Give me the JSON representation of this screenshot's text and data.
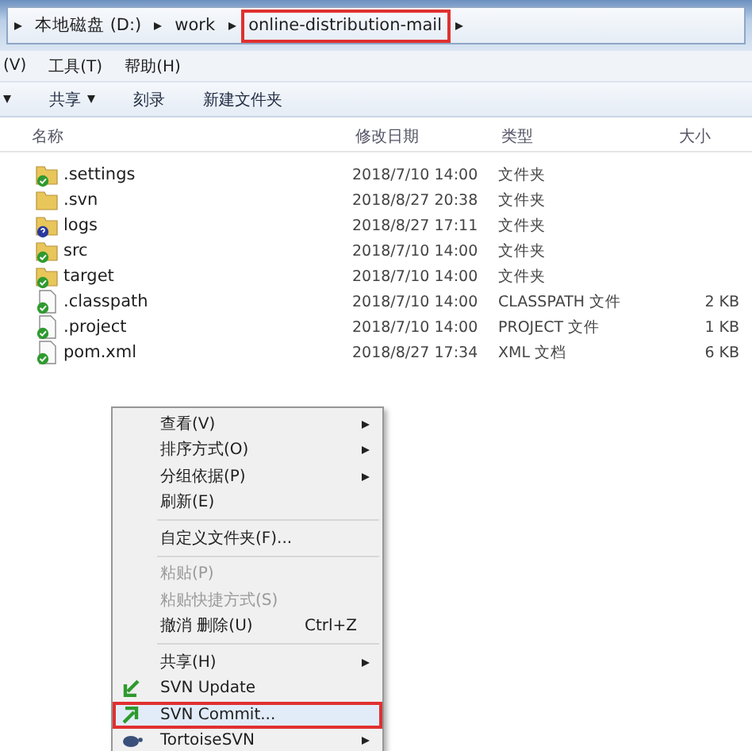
{
  "breadcrumb": [
    {
      "label": "本地磁盘 (D:)",
      "highlighted": false
    },
    {
      "label": "work",
      "highlighted": false
    },
    {
      "label": "online-distribution-mail",
      "highlighted": true
    }
  ],
  "menu_bar": [
    "(V)",
    "工具(T)",
    "帮助(H)"
  ],
  "toolbar": [
    {
      "label": "共享",
      "dropdown": true
    },
    {
      "label": "刻录",
      "dropdown": false
    },
    {
      "label": "新建文件夹",
      "dropdown": false
    }
  ],
  "table": {
    "columns": [
      "名称",
      "修改日期",
      "类型",
      "大小"
    ],
    "rows": [
      {
        "kind": "svnfolder",
        "name": ".settings",
        "date": "2018/7/10 14:00",
        "type": "文件夹"
      },
      {
        "kind": "folder",
        "name": ".svn",
        "date": "2018/8/27 20:38",
        "type": "文件夹"
      },
      {
        "kind": "newfolder",
        "name": "logs",
        "date": "2018/8/27 17:11",
        "type": "文件夹"
      },
      {
        "kind": "svnfolder",
        "name": "src",
        "date": "2018/7/10 14:00",
        "type": "文件夹"
      },
      {
        "kind": "svnfolder",
        "name": "target",
        "date": "2018/7/10 14:00",
        "type": "文件夹"
      },
      {
        "kind": "svnfile",
        "name": ".classpath",
        "date": "2018/7/10 14:00",
        "type": "CLASSPATH 文件",
        "size": "2 KB"
      },
      {
        "kind": "svnfile",
        "name": ".project",
        "date": "2018/7/10 14:00",
        "type": "PROJECT 文件",
        "size": "1 KB"
      },
      {
        "kind": "svnfile",
        "name": "pom.xml",
        "date": "2018/8/27 17:34",
        "type": "XML 文档",
        "size": "6 KB"
      }
    ]
  },
  "context_menu": [
    [
      {
        "kind": "plain",
        "label": "查看(V)",
        "submenu": true,
        "disabled": false,
        "highlighted": false
      },
      {
        "kind": "plain",
        "label": "排序方式(O)",
        "submenu": true,
        "disabled": false,
        "highlighted": false
      },
      {
        "kind": "plain",
        "label": "分组依据(P)",
        "submenu": true,
        "disabled": false,
        "highlighted": false
      },
      {
        "kind": "plain",
        "label": "刷新(E)",
        "submenu": false,
        "disabled": false,
        "highlighted": false
      }
    ],
    [
      {
        "kind": "plain",
        "label": "自定义文件夹(F)...",
        "submenu": false,
        "disabled": false,
        "highlighted": false
      }
    ],
    [
      {
        "kind": "plain",
        "label": "粘贴(P)",
        "submenu": false,
        "disabled": true,
        "highlighted": false
      },
      {
        "kind": "plain",
        "label": "粘贴快捷方式(S)",
        "submenu": false,
        "disabled": true,
        "highlighted": false
      },
      {
        "kind": "plain",
        "label": "撤消 删除(U)",
        "shortcut": "Ctrl+Z",
        "submenu": false,
        "disabled": false,
        "highlighted": false
      }
    ],
    [
      {
        "kind": "plain",
        "label": "共享(H)",
        "submenu": true,
        "disabled": false,
        "highlighted": false
      },
      {
        "kind": "update",
        "label": "SVN Update",
        "submenu": false,
        "disabled": false,
        "highlighted": false
      },
      {
        "kind": "commit",
        "label": "SVN Commit...",
        "submenu": false,
        "disabled": false,
        "highlighted": true
      },
      {
        "kind": "tortoise",
        "label": "TortoiseSVN",
        "submenu": true,
        "disabled": false,
        "highlighted": false
      }
    ]
  ]
}
